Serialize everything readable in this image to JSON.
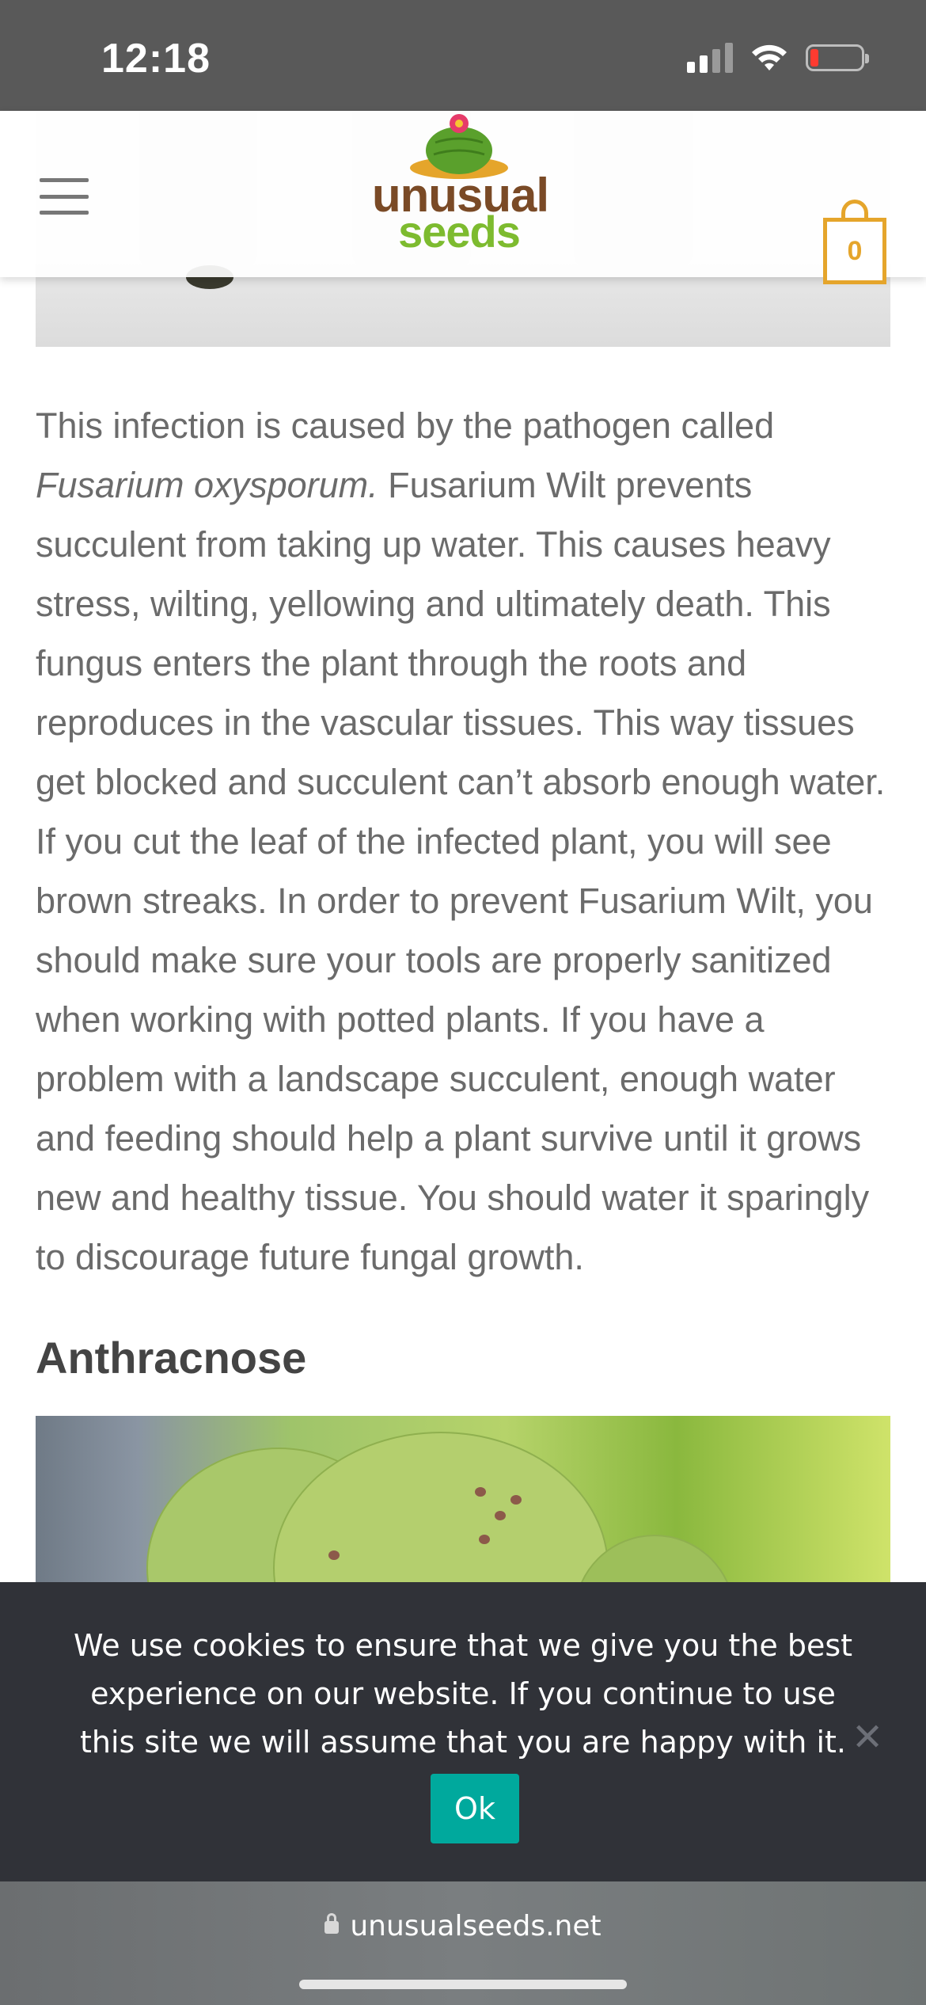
{
  "status_bar": {
    "time": "12:18",
    "icons": [
      "signal-icon",
      "wifi-icon",
      "battery-low-icon"
    ]
  },
  "header": {
    "logo_line1": "unusual",
    "logo_line2": "seeds",
    "cart_count": "0",
    "colors": {
      "logo_brown": "#7a4a26",
      "logo_green": "#7dbb2f",
      "cart_accent": "#e5a52b"
    }
  },
  "article": {
    "p1_lead": "This infection is caused by the pathogen called ",
    "p1_italic": "Fusarium oxysporum.",
    "p1_rest": " Fusarium Wilt prevents succulent from taking up water. This causes heavy stress, wilting, yellowing and ultimately death. This fungus enters the plant through the roots and reproduces in the vascular tissues. This way tissues get blocked and succulent can’t absorb enough water. If you cut the leaf of the infected plant, you will see brown streaks. In order to prevent Fusarium Wilt, you should make sure your tools are properly sanitized when working with potted plants. If you have a problem with a landscape succulent, enough water and feeding should help a plant survive until it grows new and healthy tissue. You should water it sparingly to discourage future fungal growth.",
    "heading": "Anthracnose"
  },
  "cookie_notice": {
    "text": "We use cookies to ensure that we give you the best experience on our website. If you continue to use this site we will assume that you are happy with it.",
    "ok_label": "Ok",
    "close_label": "✕",
    "colors": {
      "background": "#303238",
      "button": "#00a99d"
    }
  },
  "browser": {
    "url": "unusualseeds.net"
  }
}
